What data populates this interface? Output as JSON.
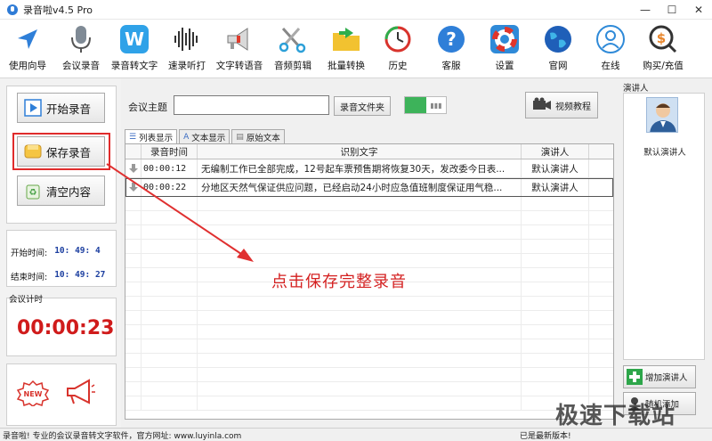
{
  "window": {
    "title": "录音啦v4.5 Pro",
    "controls": [
      "—",
      "☐",
      "✕"
    ]
  },
  "toolbar": {
    "items": [
      {
        "label": "使用向导",
        "icon": "navigation-arrow-icon"
      },
      {
        "label": "会议录音",
        "icon": "microphone-icon"
      },
      {
        "label": "录音转文字",
        "icon": "w-logo-icon"
      },
      {
        "label": "速录听打",
        "icon": "waveform-icon"
      },
      {
        "label": "文字转语音",
        "icon": "megaphone-icon"
      },
      {
        "label": "音频剪辑",
        "icon": "scissors-icon"
      },
      {
        "label": "批量转换",
        "icon": "folder-arrow-icon"
      },
      {
        "label": "历史",
        "icon": "history-clock-icon"
      },
      {
        "label": "客服",
        "icon": "help-question-icon"
      },
      {
        "label": "设置",
        "icon": "lifebuoy-icon"
      },
      {
        "label": "官网",
        "icon": "globe-icon"
      },
      {
        "label": "在线",
        "icon": "user-circle-icon"
      },
      {
        "label": "购买/充值",
        "icon": "dollar-search-icon"
      }
    ]
  },
  "left": {
    "start_label": "开始录音",
    "save_label": "保存录音",
    "clear_label": "清空内容",
    "start_time_label": "开始时间:",
    "start_time_value": "10: 49: 4",
    "end_time_label": "结束时间:",
    "end_time_value": "10: 49: 27",
    "timer_title": "会议计时",
    "timer_value": "00:00:23",
    "new_badge": "NEW"
  },
  "main": {
    "meeting_label": "会议主题",
    "meeting_value": "",
    "folder_button": "录音文件夹",
    "video_button": "视频教程",
    "tabs": [
      {
        "label": "列表显示",
        "active": true
      },
      {
        "label": "文本显示",
        "active": false
      },
      {
        "label": "原始文本",
        "active": false
      }
    ],
    "columns": [
      "录音时间",
      "识别文字",
      "演讲人"
    ],
    "rows": [
      {
        "time": "00:00:12",
        "text": "无编制工作已全部完成，12号起车票预售期将恢复30天，发改委今日表...",
        "speaker": "默认演讲人"
      },
      {
        "time": "00:00:22",
        "text": "分地区天然气保证供应问题，已经启动24小时应急值班制度保证用气稳...",
        "speaker": "默认演讲人"
      }
    ],
    "annotation": "点击保存完整录音"
  },
  "right": {
    "title": "演讲人",
    "speaker_name": "默认演讲人",
    "add_speaker_button": "增加演讲人",
    "random_add_button": "随机添加"
  },
  "status": {
    "left_text": "录音啦! 专业的会议录音转文字软件，官方网址: www.luyinla.com",
    "right_text": "已是最新版本!"
  },
  "watermark": "极速下载站",
  "colors": {
    "accent_red": "#d01b1b",
    "toggle_green": "#3db35a",
    "time_blue": "#1c3fa0"
  }
}
